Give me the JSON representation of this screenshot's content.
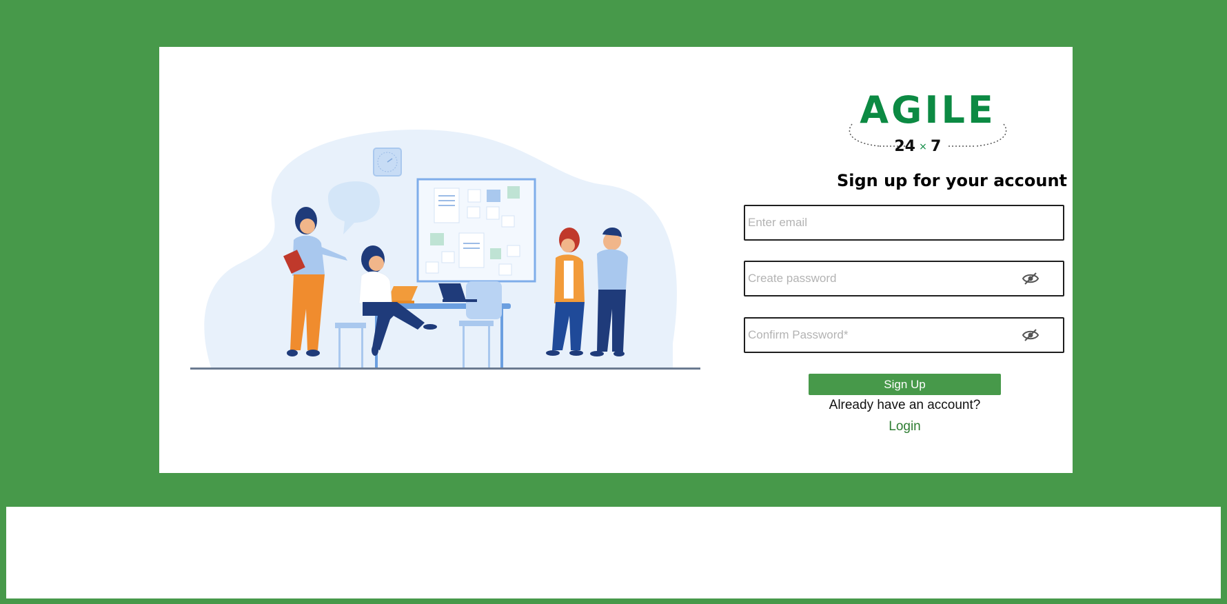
{
  "brand": {
    "logo_text": "AGILE",
    "logo_subtext_left": "24",
    "logo_subtext_mid": "×",
    "logo_subtext_right": "7",
    "accent_color": "#47994a",
    "logo_color": "#0c8a43"
  },
  "form": {
    "heading": "Sign up for your account",
    "email": {
      "placeholder": "Enter email",
      "value": ""
    },
    "password": {
      "placeholder": "Create password",
      "value": "",
      "toggle_icon": "eye-slash-icon"
    },
    "confirm_password": {
      "placeholder": "Confirm Password*",
      "value": "",
      "toggle_icon": "eye-slash-icon"
    },
    "submit_label": "Sign Up",
    "already_text": "Already have an account?",
    "login_label": "Login"
  }
}
